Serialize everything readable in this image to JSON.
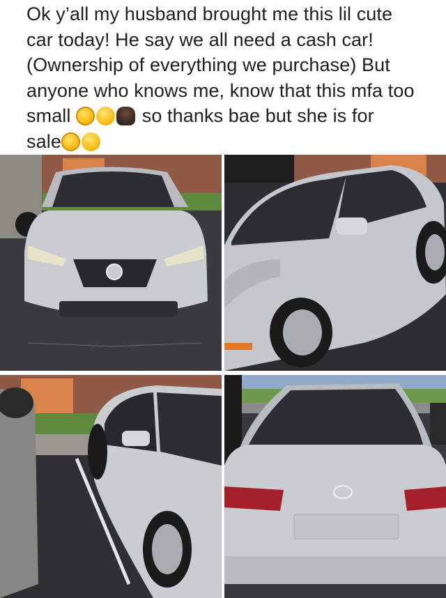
{
  "post": {
    "lines": [
      "Ok y’all my husband brought me this lil cute",
      "car today! He say we all need a cash car!",
      "(Ownership of everything we purchase) But",
      "anyone who knows me, know that this mfa too",
      "small",
      "so thanks bae but she is for",
      "sale"
    ]
  },
  "photos": [
    {
      "subject": "silver sedan front view"
    },
    {
      "subject": "silver sedan front three-quarter view"
    },
    {
      "subject": "silver sedan side view"
    },
    {
      "subject": "silver sedan rear view"
    }
  ],
  "colors": {
    "text": "#1c1e21",
    "car_silver": "#c9ccd1",
    "asphalt": "#3a3a3e",
    "brick": "#8e5a45"
  }
}
